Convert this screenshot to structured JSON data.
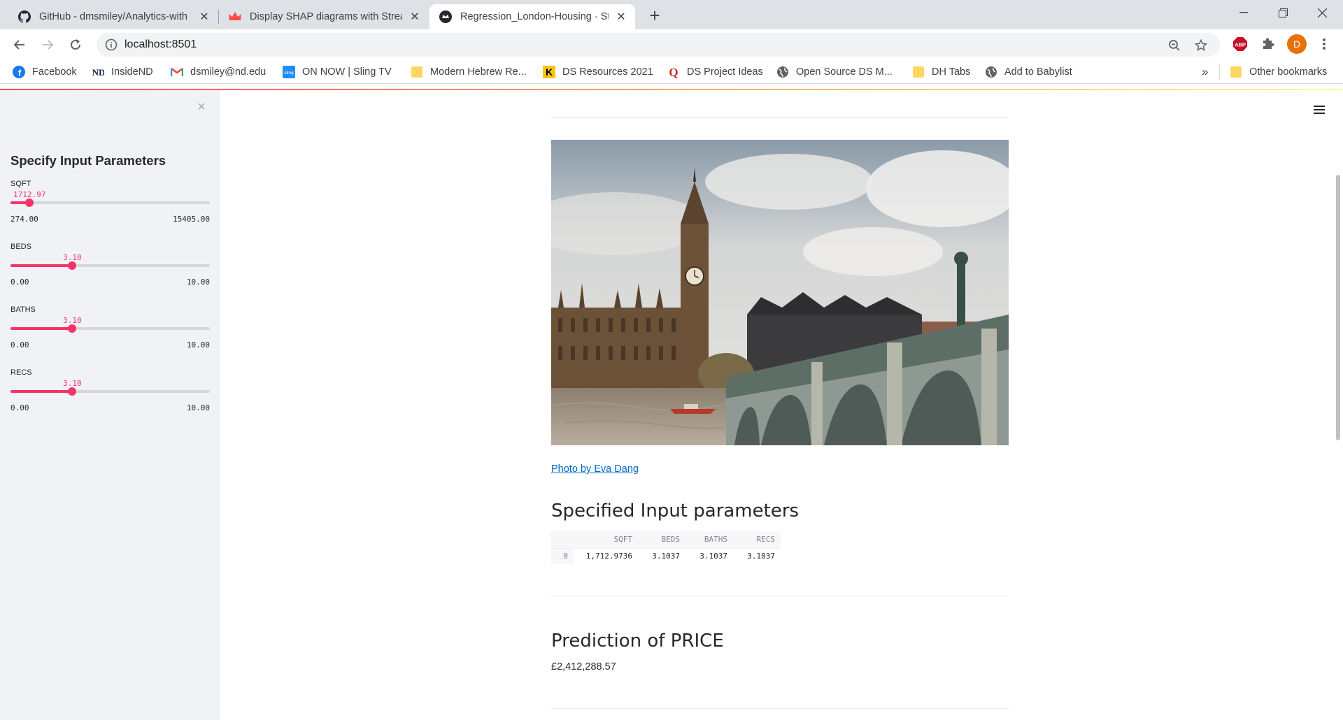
{
  "browser": {
    "tabs": [
      {
        "title": "GitHub - dmsmiley/Analytics-with",
        "favicon": "github-icon",
        "active": false
      },
      {
        "title": "Display SHAP diagrams with Strea",
        "favicon": "streamlit-crown-icon",
        "active": false
      },
      {
        "title": "Regression_London-Housing · Stre",
        "favicon": "streamlit-icon",
        "active": true
      }
    ],
    "url": "localhost:8501",
    "profile_initial": "D",
    "abp_label": "ABP",
    "bookmarks": [
      {
        "label": "Facebook",
        "icon": "facebook-icon"
      },
      {
        "label": "InsideND",
        "icon": "notre-dame-icon"
      },
      {
        "label": "dsmiley@nd.edu",
        "icon": "gmail-icon"
      },
      {
        "label": "ON NOW | Sling TV",
        "icon": "sling-icon"
      },
      {
        "label": "Modern Hebrew Re...",
        "icon": "folder-icon"
      },
      {
        "label": "DS Resources 2021",
        "icon": "k-icon"
      },
      {
        "label": "DS Project Ideas",
        "icon": "q-icon"
      },
      {
        "label": "Open Source DS M...",
        "icon": "globe-icon"
      },
      {
        "label": "DH Tabs",
        "icon": "folder-icon"
      },
      {
        "label": "Add to Babylist",
        "icon": "globe-icon"
      }
    ],
    "bookmarks_overflow": "»",
    "other_bookmarks": "Other bookmarks"
  },
  "sidebar": {
    "title": "Specify Input Parameters",
    "sliders": [
      {
        "label": "SQFT",
        "value": "1712.97",
        "min": "274.00",
        "max": "15405.00",
        "fraction": 0.0954
      },
      {
        "label": "BEDS",
        "value": "3.10",
        "min": "0.00",
        "max": "10.00",
        "fraction": 0.31
      },
      {
        "label": "BATHS",
        "value": "3.10",
        "min": "0.00",
        "max": "10.00",
        "fraction": 0.31
      },
      {
        "label": "RECS",
        "value": "3.10",
        "min": "0.00",
        "max": "10.00",
        "fraction": 0.31
      }
    ]
  },
  "main": {
    "image_caption": "Photo by Eva Dang",
    "params_heading": "Specified Input parameters",
    "table": {
      "columns": [
        "SQFT",
        "BEDS",
        "BATHS",
        "RECS"
      ],
      "rows": [
        {
          "index": "0",
          "values": [
            "1,712.9736",
            "3.1037",
            "3.1037",
            "3.1037"
          ]
        }
      ]
    },
    "prediction_heading": "Prediction of PRICE",
    "prediction_value": "£2,412,288.57"
  },
  "colors": {
    "accent": "#f63366",
    "link": "#0068c9",
    "sidebar_bg": "#f0f2f6"
  }
}
